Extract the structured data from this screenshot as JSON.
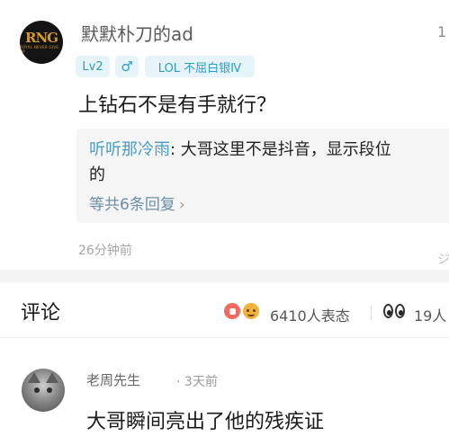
{
  "comment1": {
    "avatar_logo": "RNG",
    "avatar_sub": "ROYAL NEVER GIVE UP",
    "username": "默默朴刀的ad",
    "corner_count": "1",
    "level_badge": "Lv2",
    "gender_badge": "♂",
    "game_badge": "LOL 不屈白银Ⅳ",
    "text": "上钻石不是有手就行？",
    "reply": {
      "author": "听听那冷雨",
      "separator": ": ",
      "text_line1": "大哥这里不是抖音，显示段位",
      "text_line2": "的",
      "more_label": "等共6条回复",
      "more_chevron": "›"
    },
    "time": "26分钟前",
    "side_glyph": "ジ"
  },
  "comments_bar": {
    "title": "评论",
    "reaction_icons": [
      "like-icon",
      "smile-emoji-icon"
    ],
    "reaction_count": "6410人表态",
    "viewers_icon": "eyes-icon",
    "viewers_count": "19人"
  },
  "comment2": {
    "avatar_icon": "cat-avatar",
    "username": "老周先生",
    "separator": "·",
    "time": "3天前",
    "text": "大哥瞬间亮出了他的残疾证"
  },
  "colors": {
    "badge_bg": "#e6f4f9",
    "badge_text": "#2f9dbd",
    "reply_author": "#4b9bc2",
    "reply_bg": "#f5f5f5"
  }
}
